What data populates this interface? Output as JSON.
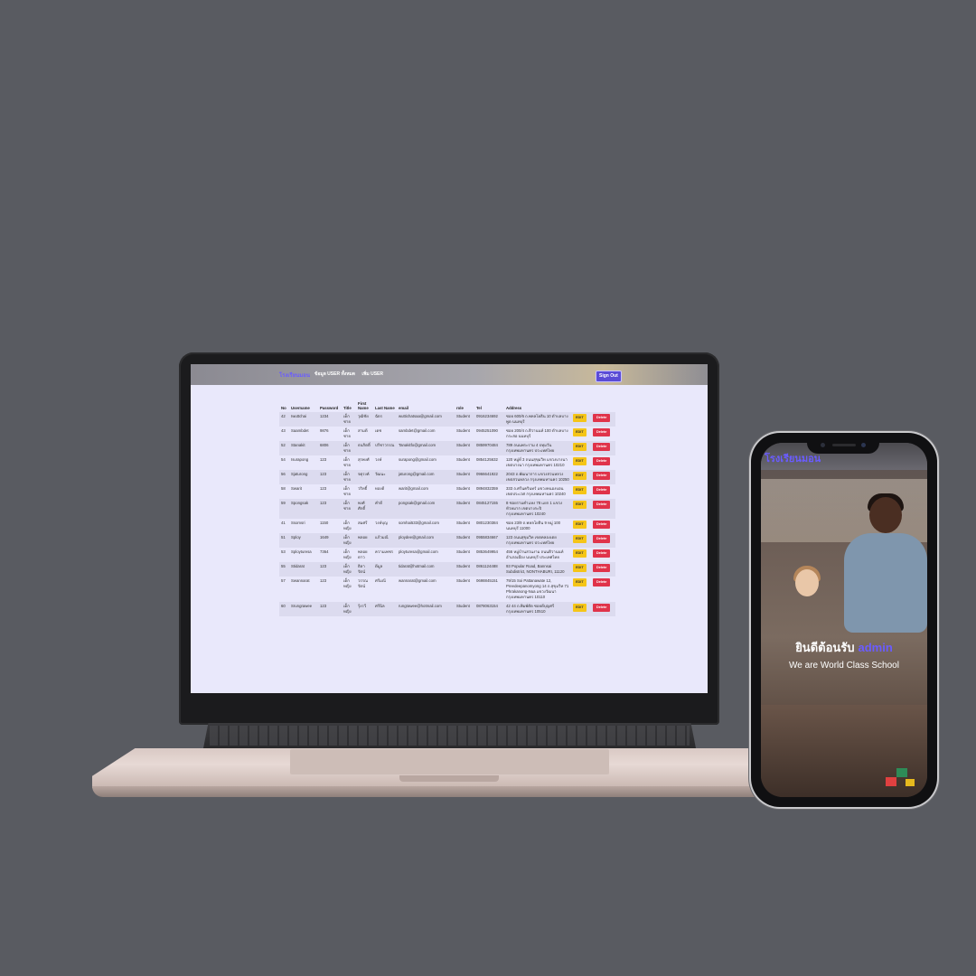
{
  "laptop": {
    "navbar": {
      "brand": "โรงเรียนมอน",
      "links": [
        "ข้อมูล USER ทั้งหมด",
        "เพิ่ม USER"
      ],
      "signout_label": "Sign Out"
    },
    "table": {
      "headers": [
        "No",
        "Username",
        "Password",
        "Title",
        "First Name",
        "Last Name",
        "email",
        "role",
        "Tel",
        "Address",
        "",
        ""
      ],
      "edit_label": "EDIT",
      "delete_label": "Delete",
      "rows": [
        {
          "no": "42",
          "username": "Iwuttchai",
          "password": "1234",
          "title": "เด็กชาย",
          "first": "วุฒิชัย",
          "last": "ฉัตร",
          "email": "wuttichatsaa@gmail.com",
          "role": "Student",
          "tel": "0916234692",
          "address": "ซอย 600/6 ถ.พหลโยธิน 10 ตำบลบางพูด นนทบุรี"
        },
        {
          "no": "43",
          "username": "Saambdet",
          "password": "9876",
          "title": "เด็กชาย",
          "first": "สามดี",
          "last": "เดช",
          "email": "sambdet@gmail.com",
          "role": "Student",
          "tel": "0945251090",
          "address": "ซอย 200/4 ถ.ติวานนท์ 100 ตำบลบางกระสอ นนทบุรี"
        },
        {
          "no": "52",
          "username": "Stanakit",
          "password": "6806",
          "title": "เด็กชาย",
          "first": "ธนกิตติ์",
          "last": "ปรีชาวรรณ",
          "email": "Tanakitfo@gmail.com",
          "role": "Student",
          "tel": "0859970484",
          "address": "789 ถนนพระราม 4 ปทุมวัน กรุงเทพมหานคร ประเทศไทย"
        },
        {
          "no": "54",
          "username": "Isurapong",
          "password": "123",
          "title": "เด็กชาย",
          "first": "สุรพงศ์",
          "last": "วงษ์",
          "email": "surapong@gmail.com",
          "role": "Student",
          "tel": "0854125632",
          "address": "120 หมู่ที่ 3 ถนนสุขุมวิท แขวงบางนา เขตบางนา กรุงเทพมหานคร 10210"
        },
        {
          "no": "56",
          "username": "Sjaturong",
          "password": "123",
          "title": "เด็กชาย",
          "first": "จตุรงค์",
          "last": "วัฒนะ",
          "email": "jaturong@gmail.com",
          "role": "Student",
          "tel": "0966641922",
          "address": "2043 ถ.พัฒนาการ แขวงสวนหลวง เขตสวนหลวง กรุงเทพมหานคร 10250"
        },
        {
          "no": "58",
          "username": "Swarit",
          "password": "123",
          "title": "เด็กชาย",
          "first": "วริทธิ์",
          "last": "ทองดี",
          "email": "warit@gmail.com",
          "role": "Student",
          "tel": "0894832359",
          "address": "333 ถ.ศรีนครินทร์ แขวงหนองบอน เขตประเวศ กรุงเทพมหานคร 10240"
        },
        {
          "no": "59",
          "username": "Spongsak",
          "password": "123",
          "title": "เด็กชาย",
          "first": "พงศ์ศักดิ์",
          "last": "คำดี",
          "email": "pongsak@gmail.com",
          "role": "Student",
          "tel": "0845127155",
          "address": "8 ซอยรามคำแหง 78 แยก 1 แขวงหัวหมาก เขตบางกะปิ กรุงเทพมหานคร 10240"
        },
        {
          "no": "41",
          "username": "Ssomsri",
          "password": "1150",
          "title": "เด็กหญิง",
          "first": "สมศรี",
          "last": "วงษ์บุญ",
          "email": "somhai533@gmail.com",
          "role": "Student",
          "tel": "0801230384",
          "address": "ซอย 23/9 ถ.พหลโยธิน 9 หมู่ 100 นนทบุรี 11000"
        },
        {
          "no": "51",
          "username": "Sploy",
          "password": "1649",
          "title": "เด็กหญิง",
          "first": "พลอย",
          "last": "แก้วมณี",
          "email": "ploydee@gmail.com",
          "role": "Student",
          "tel": "0955834667",
          "address": "123 ถนนสุขุมวิท เขตคลองเตย กรุงเทพมหานคร ประเทศไทย"
        },
        {
          "no": "53",
          "username": "Sployturesa",
          "password": "7364",
          "title": "เด็กหญิง",
          "first": "พลอยดาว",
          "last": "ความเพชร",
          "email": "ployturesa@gmail.com",
          "role": "Student",
          "tel": "0853649954",
          "address": "456 หมู่บ้านสวนงาม ถนนติวานนท์ อำเภอเมือง นนทบุรี ประเทศไทย"
        },
        {
          "no": "55",
          "username": "Stidarat",
          "password": "123",
          "title": "เด็กหญิง",
          "first": "ธิดารัตน์",
          "last": "ดีมูล",
          "email": "tidarat@hotmail.com",
          "role": "Student",
          "tel": "0861124488",
          "address": "93 Popular Road, Bannsai Subdistrict, NONTHABURI, 11120"
        },
        {
          "no": "57",
          "username": "Swannarat",
          "password": "123",
          "title": "เด็กหญิง",
          "first": "วรรณรัตน์",
          "last": "ศรีมณี",
          "email": "wannarat@gmail.com",
          "role": "Student",
          "tel": "0698845151",
          "address": "79/15 Soi Pattanawate 12, Preedeepanomyong 14 ถ.สุขุมวิท 71 Phrakanong-Nua แขวงวัฒนา กรุงเทพมหานคร 10110"
        },
        {
          "no": "60",
          "username": "Srungrawee",
          "password": "123",
          "title": "เด็กหญิง",
          "first": "รุ้งรวี",
          "last": "ศรีนิล",
          "email": "rungrawee@hotmail.com",
          "role": "Student",
          "tel": "0878063154",
          "address": "42 44 ถ.พิมพ์ตัด ซอยดีบุญศรี กรุงเทพมหานคร 10510"
        }
      ]
    }
  },
  "phone": {
    "brand": "โรงเรียนมอน",
    "welcome_text": "ยินดีต้อนรับ",
    "welcome_user": "admin",
    "tagline": "We are World Class School"
  },
  "colors": {
    "background": "#595b61",
    "accent": "#6a5cff",
    "edit_button": "#f5c518",
    "delete_button": "#e0334a",
    "table_bg": "#e9e8fb"
  }
}
